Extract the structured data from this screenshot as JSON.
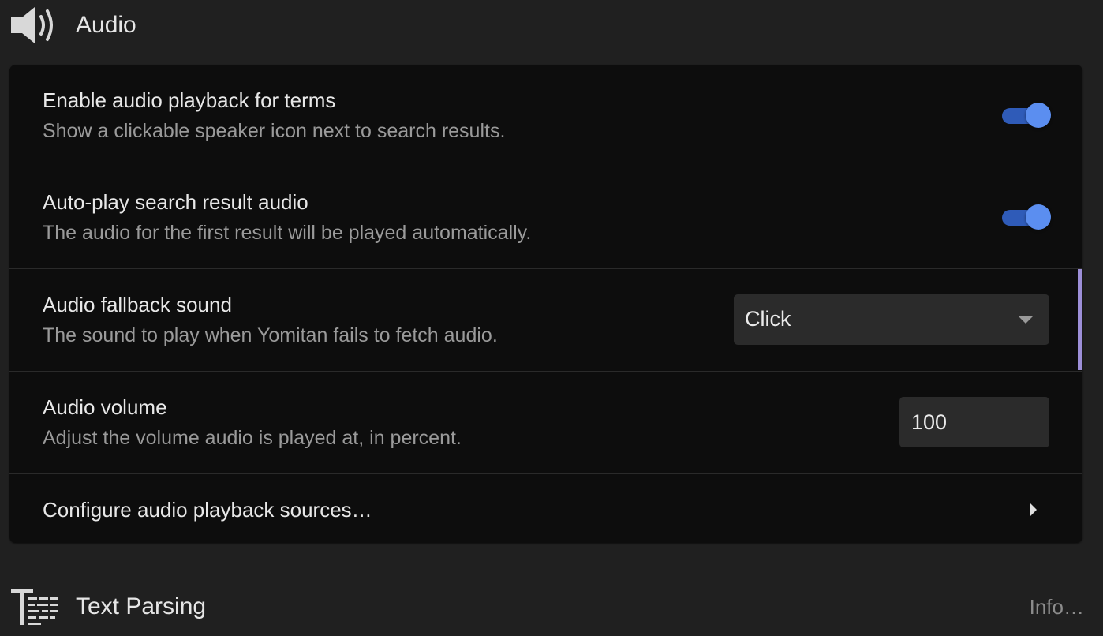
{
  "audio_section": {
    "title": "Audio",
    "icon": "speaker-icon"
  },
  "settings": [
    {
      "label": "Enable audio playback for terms",
      "description": "Show a clickable speaker icon next to search results.",
      "control": "toggle",
      "checked": true
    },
    {
      "label": "Auto-play search result audio",
      "description": "The audio for the first result will be played automatically.",
      "control": "toggle",
      "checked": true
    },
    {
      "label": "Audio fallback sound",
      "description": "The sound to play when Yomitan fails to fetch audio.",
      "control": "select",
      "value": "Click"
    },
    {
      "label": "Audio volume",
      "description": "Adjust the volume audio is played at, in percent.",
      "control": "number",
      "value": "100"
    },
    {
      "label": "Configure audio playback sources…",
      "control": "link"
    }
  ],
  "text_section": {
    "title": "Text Parsing",
    "icon": "text-parsing-icon",
    "info_link": "Info…"
  },
  "colors": {
    "background": "#202020",
    "card": "#0d0d0d",
    "toggle_track": "#2f5bb8",
    "toggle_knob": "#5b8ef0",
    "focus_bar": "#9d8fd8"
  }
}
